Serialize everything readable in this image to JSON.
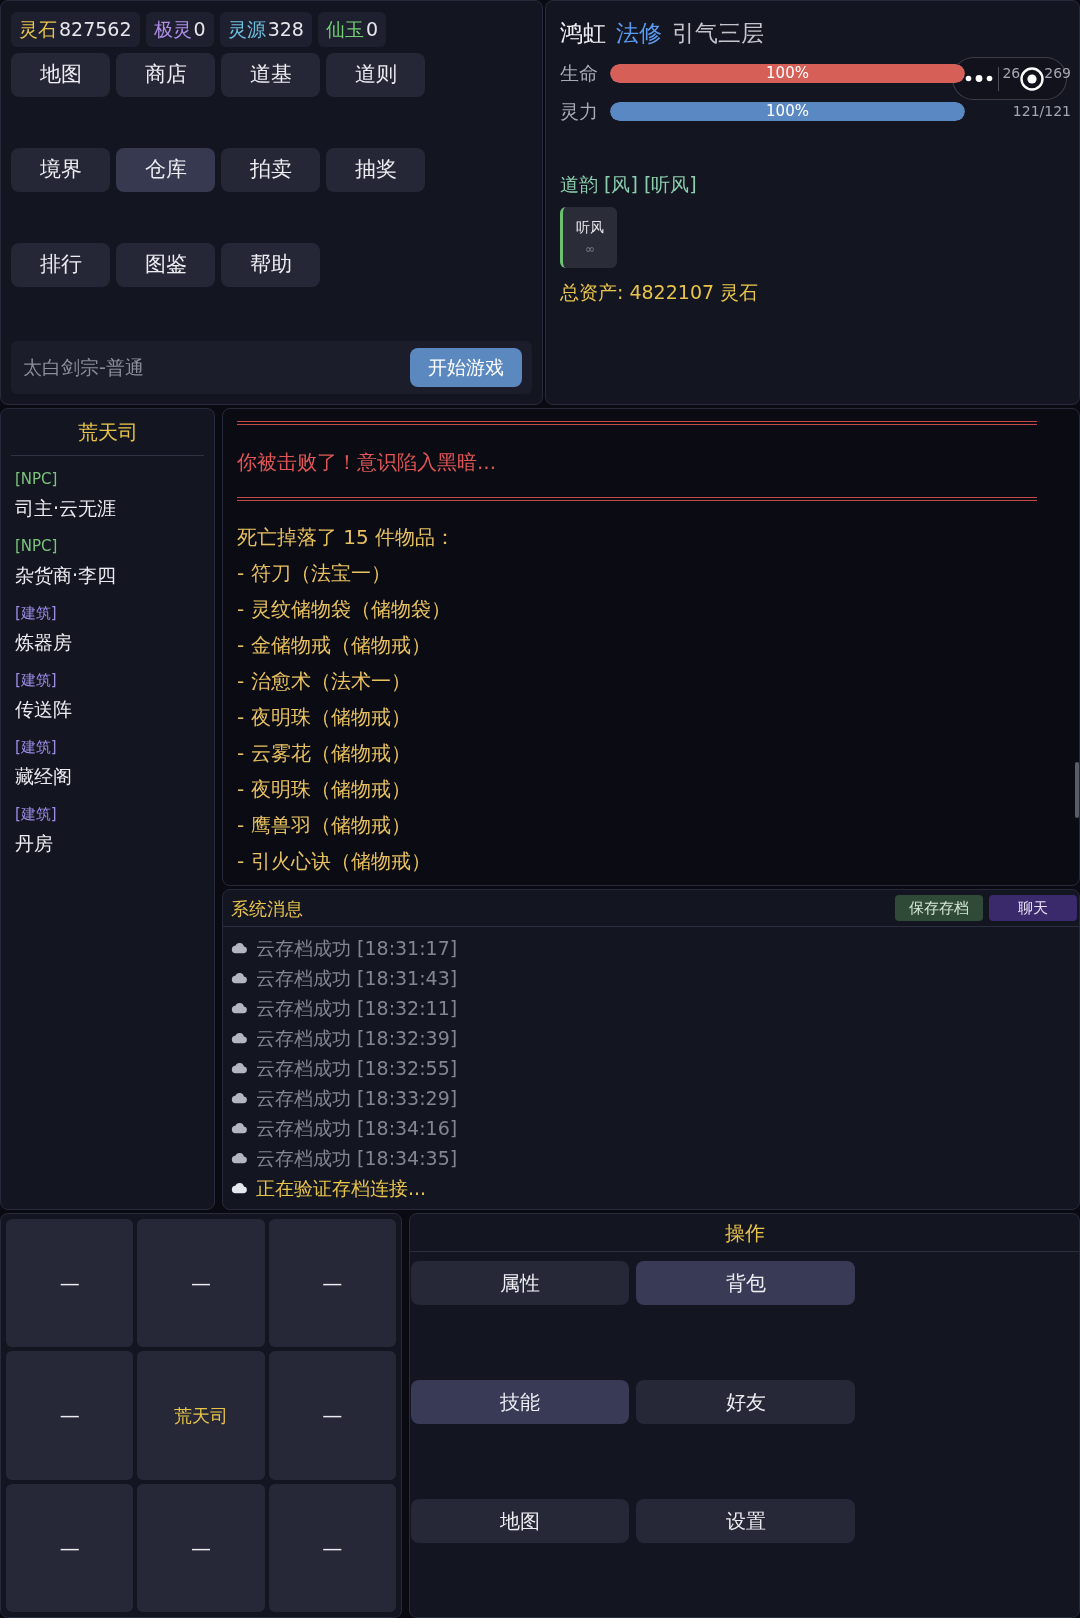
{
  "currencies": [
    {
      "label": "灵石",
      "value": "827562",
      "color": "#e8c44a"
    },
    {
      "label": "极灵",
      "value": "0",
      "color": "#b08ee8"
    },
    {
      "label": "灵源",
      "value": "328",
      "color": "#6cc0e0"
    },
    {
      "label": "仙玉",
      "value": "0",
      "color": "#72d072"
    }
  ],
  "menu_buttons": [
    {
      "label": "地图",
      "highlighted": false
    },
    {
      "label": "商店",
      "highlighted": false
    },
    {
      "label": "道基",
      "highlighted": false
    },
    {
      "label": "道则",
      "highlighted": false
    },
    {
      "label": "境界",
      "highlighted": false
    },
    {
      "label": "仓库",
      "highlighted": true
    },
    {
      "label": "拍卖",
      "highlighted": false
    },
    {
      "label": "抽奖",
      "highlighted": false
    },
    {
      "label": "排行",
      "highlighted": false
    },
    {
      "label": "图鉴",
      "highlighted": false
    },
    {
      "label": "帮助",
      "highlighted": false
    }
  ],
  "sect_bar": {
    "text": "太白剑宗-普通",
    "button": "开始游戏"
  },
  "character": {
    "name": "鸿虹",
    "class": "法修",
    "realm": "引气三层",
    "stats": [
      {
        "label": "生命",
        "level": 1,
        "bar_text": "100%",
        "reading": [
          "26",
          "269"
        ],
        "color": "#d65f58"
      },
      {
        "label": "灵力",
        "level": 1,
        "bar_text": "100%",
        "reading": [
          "121/121"
        ],
        "color": "#5a88c2"
      }
    ],
    "dao_yun": "道韵 [风] [听风]",
    "tags": [
      {
        "name": "听风",
        "duration": "∞"
      }
    ],
    "total_assets": "总资产: 4822107 灵石"
  },
  "location": {
    "title": "荒天司",
    "entries": [
      {
        "kind": "npc",
        "tag": "[NPC]",
        "name": "司主·云无涯"
      },
      {
        "kind": "npc",
        "tag": "[NPC]",
        "name": "杂货商·李四"
      },
      {
        "kind": "building",
        "tag": "[建筑]",
        "name": "炼器房"
      },
      {
        "kind": "building",
        "tag": "[建筑]",
        "name": "传送阵"
      },
      {
        "kind": "building",
        "tag": "[建筑]",
        "name": "藏经阁"
      },
      {
        "kind": "building",
        "tag": "[建筑]",
        "name": "丹房"
      }
    ]
  },
  "battle_log": [
    {
      "kind": "divider"
    },
    {
      "kind": "defeat",
      "text": "你被击败了！意识陷入黑暗..."
    },
    {
      "kind": "divider"
    },
    {
      "kind": "loot",
      "text": "死亡掉落了 15 件物品："
    },
    {
      "kind": "loot",
      "text": "- 符刀（法宝一）"
    },
    {
      "kind": "loot",
      "text": "- 灵纹储物袋（储物袋）"
    },
    {
      "kind": "loot",
      "text": "- 金储物戒（储物戒）"
    },
    {
      "kind": "loot",
      "text": "- 治愈术（法术一）"
    },
    {
      "kind": "loot",
      "text": "- 夜明珠（储物戒）"
    },
    {
      "kind": "loot",
      "text": "- 云雾花（储物戒）"
    },
    {
      "kind": "loot",
      "text": "- 夜明珠（储物戒）"
    },
    {
      "kind": "loot",
      "text": "- 鹰兽羽（储物戒）"
    },
    {
      "kind": "loot",
      "text": "- 引火心诀（储物戒）"
    }
  ],
  "system_messages": {
    "title": "系统消息",
    "buttons": [
      {
        "kind": "save",
        "label": "保存存档"
      },
      {
        "kind": "chat",
        "label": "聊天"
      }
    ],
    "messages": [
      {
        "kind": "done",
        "text": "云存档成功 [18:31:17]"
      },
      {
        "kind": "done",
        "text": "云存档成功 [18:31:43]"
      },
      {
        "kind": "done",
        "text": "云存档成功 [18:32:11]"
      },
      {
        "kind": "done",
        "text": "云存档成功 [18:32:39]"
      },
      {
        "kind": "done",
        "text": "云存档成功 [18:32:55]"
      },
      {
        "kind": "done",
        "text": "云存档成功 [18:33:29]"
      },
      {
        "kind": "done",
        "text": "云存档成功 [18:34:16]"
      },
      {
        "kind": "done",
        "text": "云存档成功 [18:34:35]"
      },
      {
        "kind": "pending",
        "text": "正在验证存档连接..."
      }
    ]
  },
  "map_grid": [
    {
      "label": "—",
      "current": false
    },
    {
      "label": "—",
      "current": false
    },
    {
      "label": "—",
      "current": false
    },
    {
      "label": "—",
      "current": false
    },
    {
      "label": "荒天司",
      "current": true
    },
    {
      "label": "—",
      "current": false
    },
    {
      "label": "—",
      "current": false
    },
    {
      "label": "—",
      "current": false
    },
    {
      "label": "—",
      "current": false
    }
  ],
  "actions": {
    "title": "操作",
    "buttons": [
      {
        "label": "属性",
        "highlighted": false
      },
      {
        "label": "背包",
        "highlighted": true
      },
      {
        "label": "技能",
        "highlighted": true
      },
      {
        "label": "好友",
        "highlighted": false
      },
      {
        "label": "地图",
        "highlighted": false
      },
      {
        "label": "设置",
        "highlighted": false
      }
    ]
  }
}
